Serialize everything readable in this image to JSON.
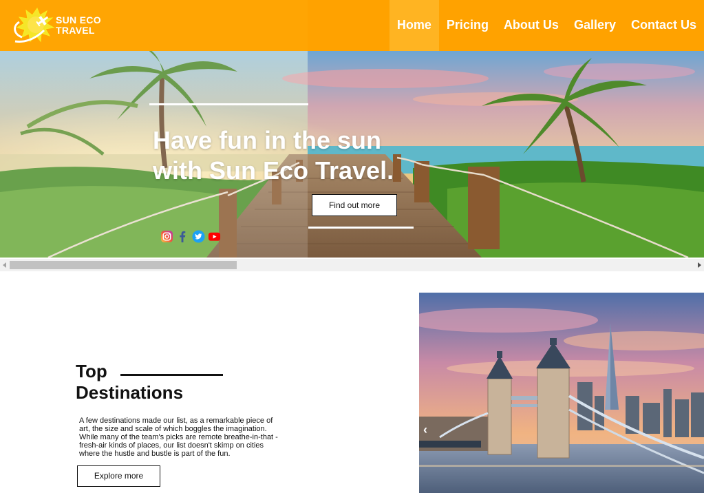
{
  "brand": {
    "line1": "SUN ECO",
    "line2": "TRAVEL",
    "logo_icon": "sun-airplane-logo"
  },
  "nav": {
    "items": [
      {
        "label": "Home",
        "active": true
      },
      {
        "label": "Pricing"
      },
      {
        "label": "About Us"
      },
      {
        "label": "Gallery"
      },
      {
        "label": "Contact Us"
      }
    ]
  },
  "hero": {
    "title_line1": "Have fun in the sun",
    "title_line2": "with Sun Eco Travel.",
    "cta_label": "Find out more",
    "socials": [
      "instagram-icon",
      "facebook-icon",
      "twitter-icon",
      "youtube-icon"
    ]
  },
  "destinations": {
    "title_line1": "Top",
    "title_line2": "Destinations",
    "body": "A few destinations made our list, as a remarkable piece of art, the size and scale of which boggles the imagination. While many of the team's picks are remote breathe-in-that -fresh-air kinds of places, our list doesn't skimp on cities where the hustle and bustle is part of the fun.",
    "cta_label": "Explore more",
    "prev_arrow": "‹"
  },
  "colors": {
    "brand_orange": "#ffa200",
    "active_tab": "#ffb422"
  }
}
